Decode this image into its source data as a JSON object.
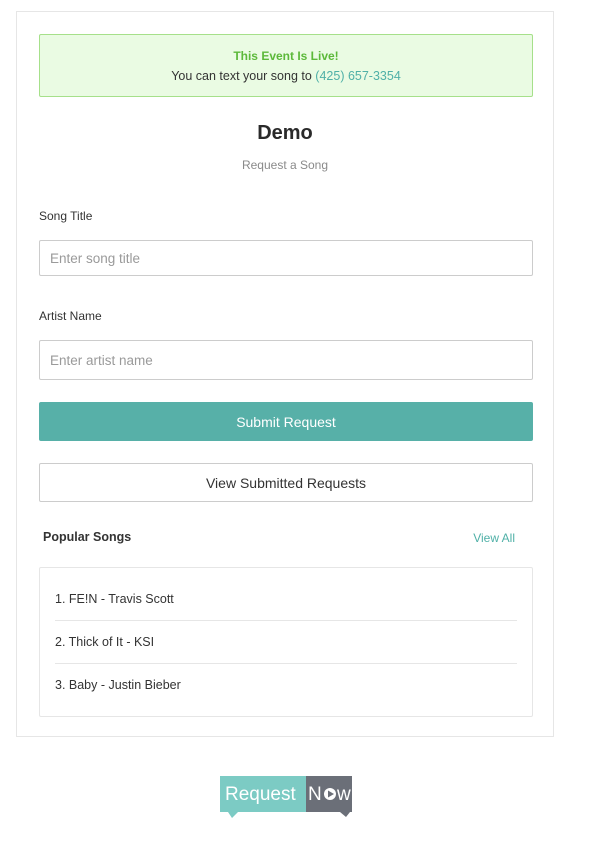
{
  "alert": {
    "title": "This Event Is Live!",
    "text_prefix": "You can text your song to ",
    "phone": "(425) 657-3354"
  },
  "event": {
    "title": "Demo",
    "subtitle": "Request a Song"
  },
  "form": {
    "song_label": "Song Title",
    "song_placeholder": "Enter song title",
    "song_value": "",
    "artist_label": "Artist Name",
    "artist_placeholder": "Enter artist name",
    "artist_value": "",
    "submit_label": "Submit Request",
    "view_label": "View Submitted Requests"
  },
  "popular": {
    "title": "Popular Songs",
    "view_all": "View All",
    "songs": [
      "1. FE!N - Travis Scott",
      "2. Thick of It - KSI",
      "3. Baby - Justin Bieber"
    ]
  },
  "logo": {
    "text_left": "Request",
    "text_right_n": "N",
    "text_right_w": "w"
  },
  "colors": {
    "accent": "#57b0a8",
    "alert_bg": "#eafbe3",
    "alert_border": "#a6e08a",
    "alert_title": "#5cb93a",
    "logo_left": "#7ccbc4",
    "logo_right": "#6b6f78"
  }
}
